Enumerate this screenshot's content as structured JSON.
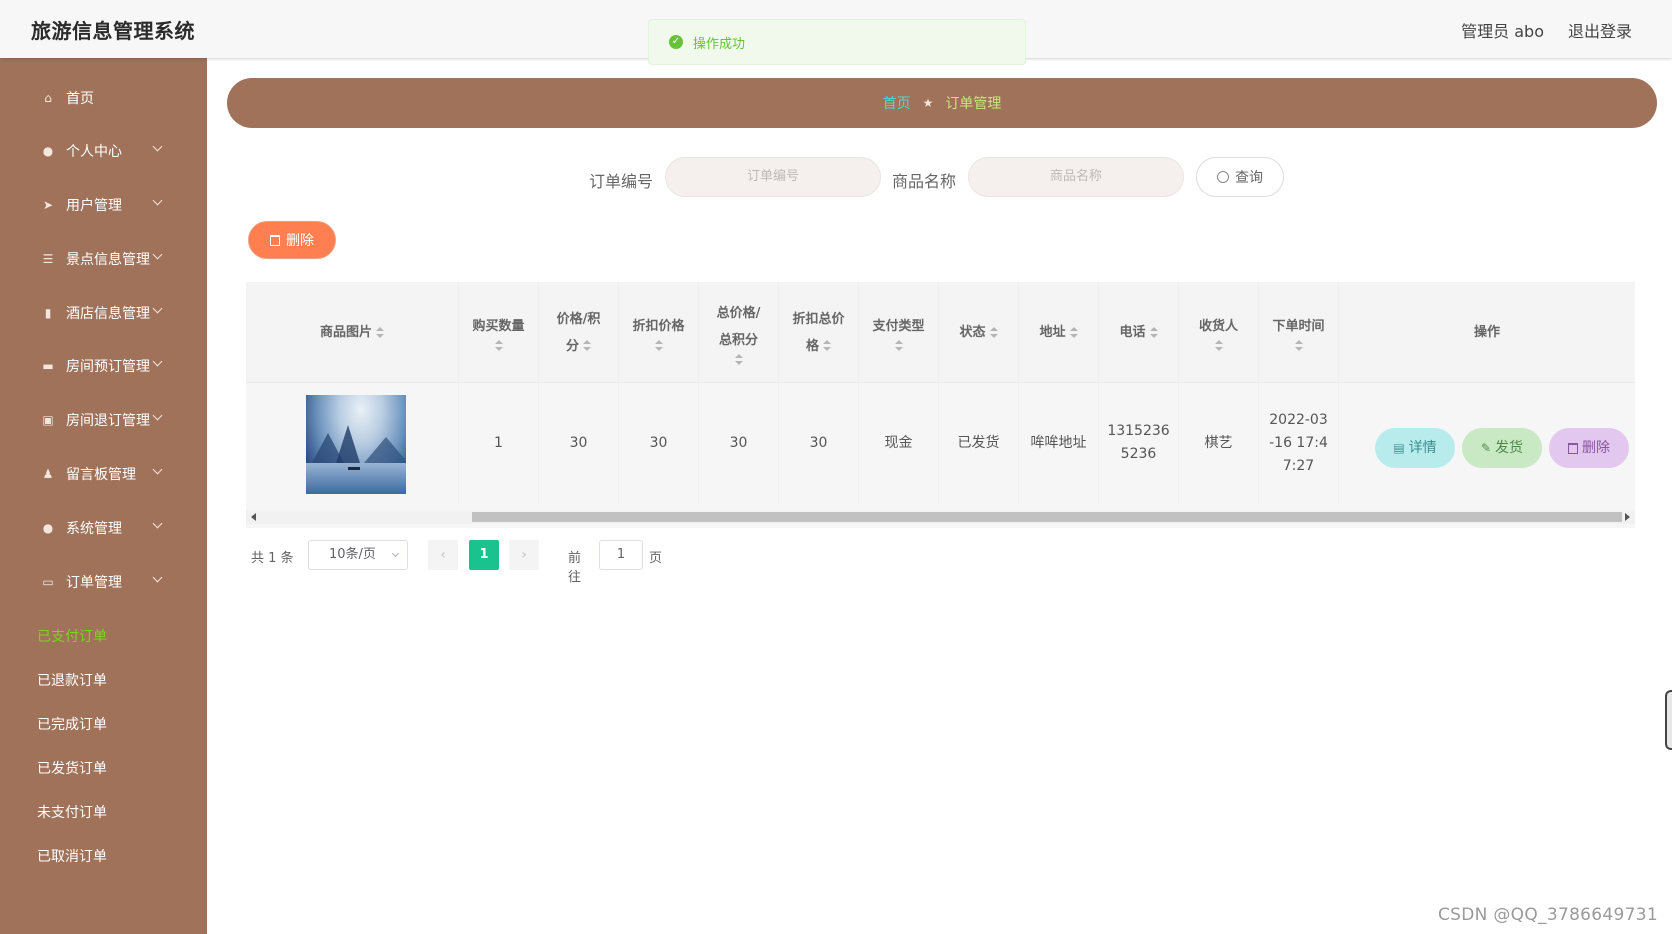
{
  "header": {
    "app_title": "旅游信息管理系统",
    "user_label": "管理员 abo",
    "logout": "退出登录"
  },
  "toast": {
    "message": "操作成功"
  },
  "sidebar": {
    "items": [
      {
        "label": "首页",
        "icon": "home-icon"
      },
      {
        "label": "个人中心",
        "icon": "user-icon"
      },
      {
        "label": "用户管理",
        "icon": "send-icon"
      },
      {
        "label": "景点信息管理",
        "icon": "sliders-icon"
      },
      {
        "label": "酒店信息管理",
        "icon": "bar-chart-icon"
      },
      {
        "label": "房间预订管理",
        "icon": "ticket-icon"
      },
      {
        "label": "房间退订管理",
        "icon": "clipboard-icon"
      },
      {
        "label": "留言板管理",
        "icon": "person-stand-icon"
      },
      {
        "label": "系统管理",
        "icon": "user-icon"
      },
      {
        "label": "订单管理",
        "icon": "monitor-icon"
      }
    ],
    "sub_items": [
      "已支付订单",
      "已退款订单",
      "已完成订单",
      "已发货订单",
      "未支付订单",
      "已取消订单"
    ],
    "active_sub": "已支付订单"
  },
  "breadcrumb": {
    "home": "首页",
    "current": "订单管理"
  },
  "search": {
    "order_no_label": "订单编号",
    "order_no_placeholder": "订单编号",
    "goods_label": "商品名称",
    "goods_placeholder": "商品名称",
    "query_button": "查询"
  },
  "toolbar": {
    "delete_label": "删除"
  },
  "table": {
    "columns": [
      {
        "line1": "商品图片",
        "line2": ""
      },
      {
        "line1": "购买数量",
        "line2": ""
      },
      {
        "line1": "价格/积",
        "line2": "分"
      },
      {
        "line1": "折扣价格",
        "line2": ""
      },
      {
        "line1": "总价格/",
        "line2": "总积分"
      },
      {
        "line1": "折扣总价",
        "line2": "格"
      },
      {
        "line1": "支付类型",
        "line2": ""
      },
      {
        "line1": "状态",
        "line2": ""
      },
      {
        "line1": "地址",
        "line2": ""
      },
      {
        "line1": "电话",
        "line2": ""
      },
      {
        "line1": "收货人",
        "line2": ""
      },
      {
        "line1": "下单时间",
        "line2": ""
      },
      {
        "line1": "操作",
        "line2": ""
      }
    ],
    "rows": [
      {
        "quantity": "1",
        "price": "30",
        "discount_price": "30",
        "total_price": "30",
        "discount_total": "30",
        "pay_type": "现金",
        "status": "已发货",
        "address": "哞哞地址",
        "phone_1": "1315236",
        "phone_2": "5236",
        "receiver": "棋艺",
        "time_1": "2022-03",
        "time_2": "-16 17:4",
        "time_3": "7:27"
      }
    ],
    "actions": {
      "detail": "详情",
      "ship": "发货",
      "delete": "删除"
    },
    "action_colors": {
      "detail": "#b8ecec",
      "ship": "#c8e9c4",
      "delete": "#e2c7ee"
    }
  },
  "pagination": {
    "total": "共 1 条",
    "page_size": "10条/页",
    "current_page": "1",
    "goto_label": "前往",
    "jump_value": "1",
    "page_suffix": "页"
  },
  "watermark": "CSDN @QQ_3786649731",
  "colors": {
    "sidebar_bg": "#a0725a",
    "accent_green": "#1ac28d",
    "delete_orange": "#ff7f50",
    "active_menu": "#7ed321",
    "crumb_home": "#40e0d0"
  }
}
